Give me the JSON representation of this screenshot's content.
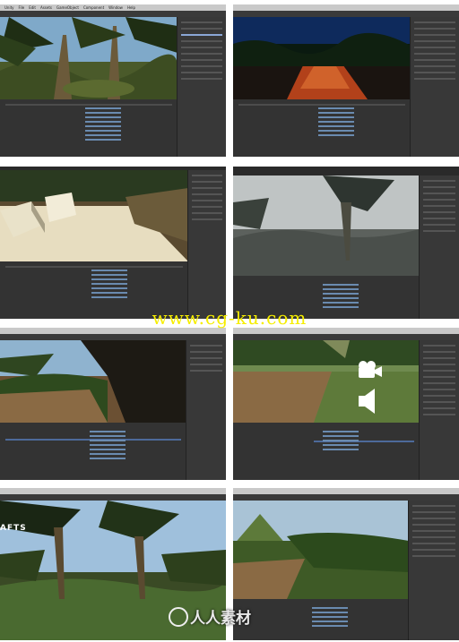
{
  "menus": {
    "items": [
      "Unity",
      "File",
      "Edit",
      "Assets",
      "GameObject",
      "Component",
      "Window",
      "Help"
    ]
  },
  "overlay": {
    "url_watermark": "www.cg-ku.com",
    "brand_watermark": "人人素材",
    "partial_text": "AFTS"
  },
  "colors": {
    "url_watermark": "#f6ee00",
    "editor_bg": "#2a2a2a",
    "selection": "#8aa7d6"
  },
  "icons": {
    "camera": "camera-gizmo-icon",
    "speaker": "audio-source-gizmo-icon"
  }
}
